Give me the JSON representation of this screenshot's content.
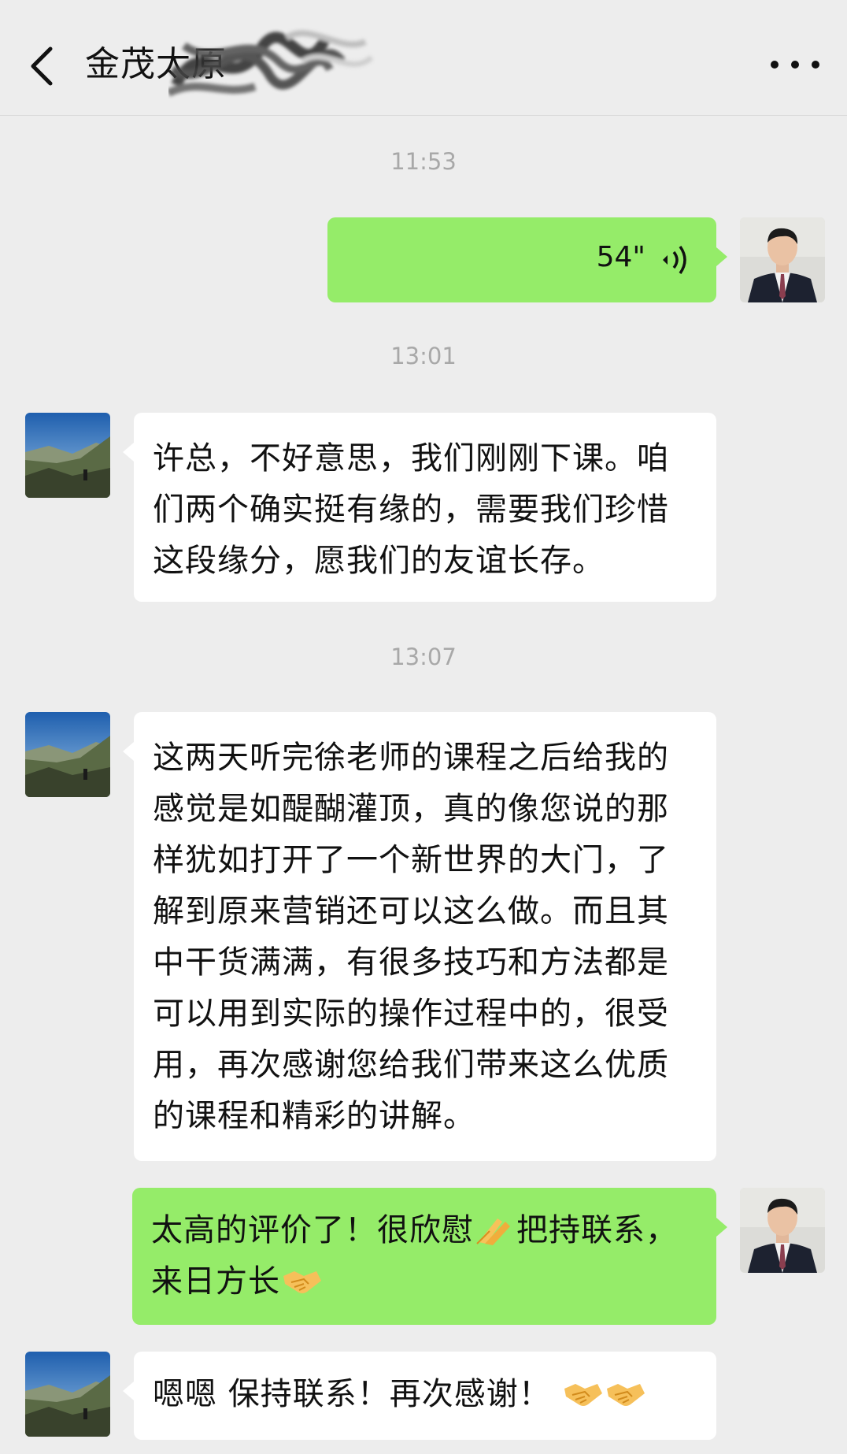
{
  "header": {
    "title": "金茂太原",
    "back_icon": "chevron-left-icon",
    "more_icon": "more-dots-icon"
  },
  "messages": [
    {
      "type": "time",
      "text": "11:53"
    },
    {
      "type": "voice",
      "side": "right",
      "duration": "54\"",
      "icon": "voice-wave-icon"
    },
    {
      "type": "time",
      "text": "13:01"
    },
    {
      "type": "text",
      "side": "left",
      "text": "许总，不好意思，我们刚刚下课。咱们两个确实挺有缘的，需要我们珍惜这段缘分，愿我们的友谊长存。"
    },
    {
      "type": "time",
      "text": "13:07"
    },
    {
      "type": "text",
      "side": "left",
      "text": "这两天听完徐老师的课程之后给我的感觉是如醍醐灌顶，真的像您说的那样犹如打开了一个新世界的大门，了解到原来营销还可以这么做。而且其中干货满满，有很多技巧和方法都是可以用到实际的操作过程中的，很受用，再次感谢您给我们带来这么优质的课程和精彩的讲解。"
    },
    {
      "type": "text",
      "side": "right",
      "text_parts": [
        "太高的评价了！很欣慰",
        "把持联系，来日方长"
      ],
      "emoji": [
        "folded-hands-emoji",
        "handshake-emoji"
      ]
    },
    {
      "type": "text",
      "side": "left",
      "text": "嗯嗯 保持联系！再次感谢！",
      "emoji": [
        "handshake-emoji",
        "handshake-emoji"
      ]
    }
  ],
  "colors": {
    "background": "#ededed",
    "self_bubble": "#95ec69",
    "other_bubble": "#ffffff",
    "timestamp": "#a8a8a8"
  }
}
